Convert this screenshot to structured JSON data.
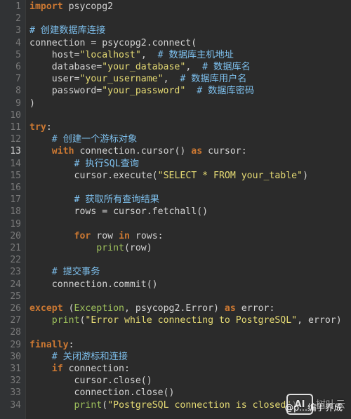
{
  "editor": {
    "language": "python",
    "active_line": 13,
    "lines": [
      {
        "n": "1",
        "html": [
          [
            "kw",
            "import"
          ],
          [
            "fn",
            " psycopg2"
          ]
        ]
      },
      {
        "n": "2",
        "html": []
      },
      {
        "n": "3",
        "html": [
          [
            "cm",
            "# 创建数据库连接"
          ]
        ]
      },
      {
        "n": "4",
        "html": [
          [
            "fn",
            "connection = psycopg2.connect("
          ]
        ]
      },
      {
        "n": "5",
        "html": [
          [
            "fn",
            "    host="
          ],
          [
            "str",
            "\"localhost\""
          ],
          [
            "fn",
            ",  "
          ],
          [
            "cm",
            "# 数据库主机地址"
          ]
        ]
      },
      {
        "n": "6",
        "html": [
          [
            "fn",
            "    database="
          ],
          [
            "str",
            "\"your_database\""
          ],
          [
            "fn",
            ",  "
          ],
          [
            "cm",
            "# 数据库名"
          ]
        ]
      },
      {
        "n": "7",
        "html": [
          [
            "fn",
            "    user="
          ],
          [
            "str",
            "\"your_username\""
          ],
          [
            "fn",
            ",  "
          ],
          [
            "cm",
            "# 数据库用户名"
          ]
        ]
      },
      {
        "n": "8",
        "html": [
          [
            "fn",
            "    password="
          ],
          [
            "str",
            "\"your_password\""
          ],
          [
            "fn",
            "  "
          ],
          [
            "cm",
            "# 数据库密码"
          ]
        ]
      },
      {
        "n": "9",
        "html": [
          [
            "fn",
            ")"
          ]
        ]
      },
      {
        "n": "10",
        "html": []
      },
      {
        "n": "11",
        "html": [
          [
            "kw",
            "try"
          ],
          [
            "fn",
            ":"
          ]
        ]
      },
      {
        "n": "12",
        "html": [
          [
            "fn",
            "    "
          ],
          [
            "cm",
            "# 创建一个游标对象"
          ]
        ]
      },
      {
        "n": "13",
        "html": [
          [
            "fn",
            "    "
          ],
          [
            "kw",
            "with"
          ],
          [
            "fn",
            " connection.cursor() "
          ],
          [
            "kw",
            "as"
          ],
          [
            "fn",
            " cursor:"
          ]
        ]
      },
      {
        "n": "14",
        "html": [
          [
            "fn",
            "        "
          ],
          [
            "cm",
            "# 执行SQL查询"
          ]
        ]
      },
      {
        "n": "15",
        "html": [
          [
            "fn",
            "        cursor.execute("
          ],
          [
            "str",
            "\"SELECT * FROM your_table\""
          ],
          [
            "fn",
            ")"
          ]
        ]
      },
      {
        "n": "16",
        "html": []
      },
      {
        "n": "17",
        "html": [
          [
            "fn",
            "        "
          ],
          [
            "cm",
            "# 获取所有查询结果"
          ]
        ]
      },
      {
        "n": "18",
        "html": [
          [
            "fn",
            "        rows = cursor.fetchall()"
          ]
        ]
      },
      {
        "n": "19",
        "html": []
      },
      {
        "n": "20",
        "html": [
          [
            "fn",
            "        "
          ],
          [
            "kw",
            "for"
          ],
          [
            "fn",
            " row "
          ],
          [
            "kw",
            "in"
          ],
          [
            "fn",
            " rows:"
          ]
        ]
      },
      {
        "n": "21",
        "html": [
          [
            "fn",
            "            "
          ],
          [
            "bi",
            "print"
          ],
          [
            "fn",
            "(row)"
          ]
        ]
      },
      {
        "n": "22",
        "html": []
      },
      {
        "n": "23",
        "html": [
          [
            "fn",
            "    "
          ],
          [
            "cm",
            "# 提交事务"
          ]
        ]
      },
      {
        "n": "24",
        "html": [
          [
            "fn",
            "    connection.commit()"
          ]
        ]
      },
      {
        "n": "25",
        "html": []
      },
      {
        "n": "26",
        "html": [
          [
            "kw",
            "except"
          ],
          [
            "fn",
            " ("
          ],
          [
            "ex",
            "Exception"
          ],
          [
            "fn",
            ", psycopg2.Error) "
          ],
          [
            "kw",
            "as"
          ],
          [
            "fn",
            " error:"
          ]
        ]
      },
      {
        "n": "27",
        "html": [
          [
            "fn",
            "    "
          ],
          [
            "bi",
            "print"
          ],
          [
            "fn",
            "("
          ],
          [
            "str",
            "\"Error while connecting to PostgreSQL\""
          ],
          [
            "fn",
            ", error)"
          ]
        ]
      },
      {
        "n": "28",
        "html": []
      },
      {
        "n": "29",
        "html": [
          [
            "kw",
            "finally"
          ],
          [
            "fn",
            ":"
          ]
        ]
      },
      {
        "n": "30",
        "html": [
          [
            "fn",
            "    "
          ],
          [
            "cm",
            "# 关闭游标和连接"
          ]
        ]
      },
      {
        "n": "31",
        "html": [
          [
            "fn",
            "    "
          ],
          [
            "kw",
            "if"
          ],
          [
            "fn",
            " connection:"
          ]
        ]
      },
      {
        "n": "32",
        "html": [
          [
            "fn",
            "        cursor.close()"
          ]
        ]
      },
      {
        "n": "33",
        "html": [
          [
            "fn",
            "        connection.close()"
          ]
        ]
      },
      {
        "n": "34",
        "html": [
          [
            "fn",
            "        "
          ],
          [
            "bi",
            "print"
          ],
          [
            "fn",
            "("
          ],
          [
            "str",
            "\"PostgreSQL connection is closed\""
          ],
          [
            "fn",
            ")"
          ]
        ]
      }
    ]
  },
  "watermark": {
    "logo": "AI",
    "site": "树叶云",
    "author": "@p...编手养成"
  },
  "colors": {
    "background": "#2b2b2b",
    "keyword": "#cc7832",
    "string": "#e6db74",
    "comment": "#7ec0ee",
    "builtin": "#9fc25c",
    "line_number": "#7a7a7a"
  }
}
